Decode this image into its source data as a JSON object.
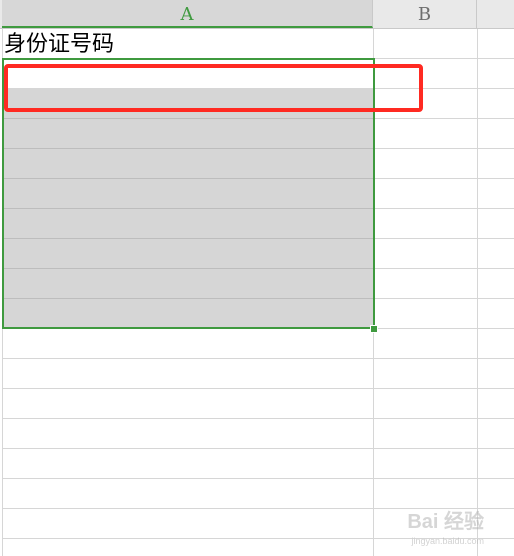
{
  "columns": [
    "A",
    "B"
  ],
  "cells": {
    "a1": "身份证号码"
  },
  "colors": {
    "selection_border": "#3f9a3f",
    "highlight_box": "#ff2a22",
    "selected_fill": "#d6d6d6"
  },
  "watermark": {
    "logo_text": "Bai 经验",
    "sub_text": "jingyan.baidu.com"
  }
}
